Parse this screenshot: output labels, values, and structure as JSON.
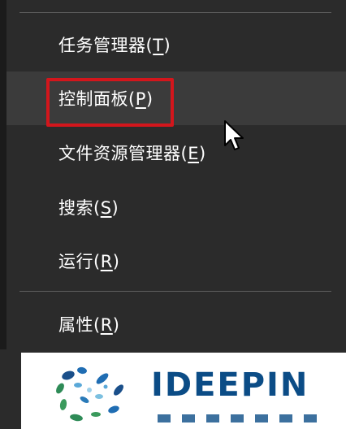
{
  "menu": {
    "items": [
      {
        "label": "任务管理器(",
        "key": "T",
        "suffix": ")"
      },
      {
        "label": "控制面板(",
        "key": "P",
        "suffix": ")"
      },
      {
        "label": "文件资源管理器(",
        "key": "E",
        "suffix": ")"
      },
      {
        "label": "搜索(",
        "key": "S",
        "suffix": ")"
      },
      {
        "label": "运行(",
        "key": "R",
        "suffix": ")"
      },
      {
        "label": "属性(",
        "key": "R",
        "suffix": ")"
      }
    ],
    "hovered_index": 1
  },
  "highlight_color": "#d3161c",
  "watermark": {
    "text": "IDEEPIN"
  },
  "icons": {
    "cursor": "arrow-cursor-icon",
    "logo": "deepin-logo-icon"
  }
}
